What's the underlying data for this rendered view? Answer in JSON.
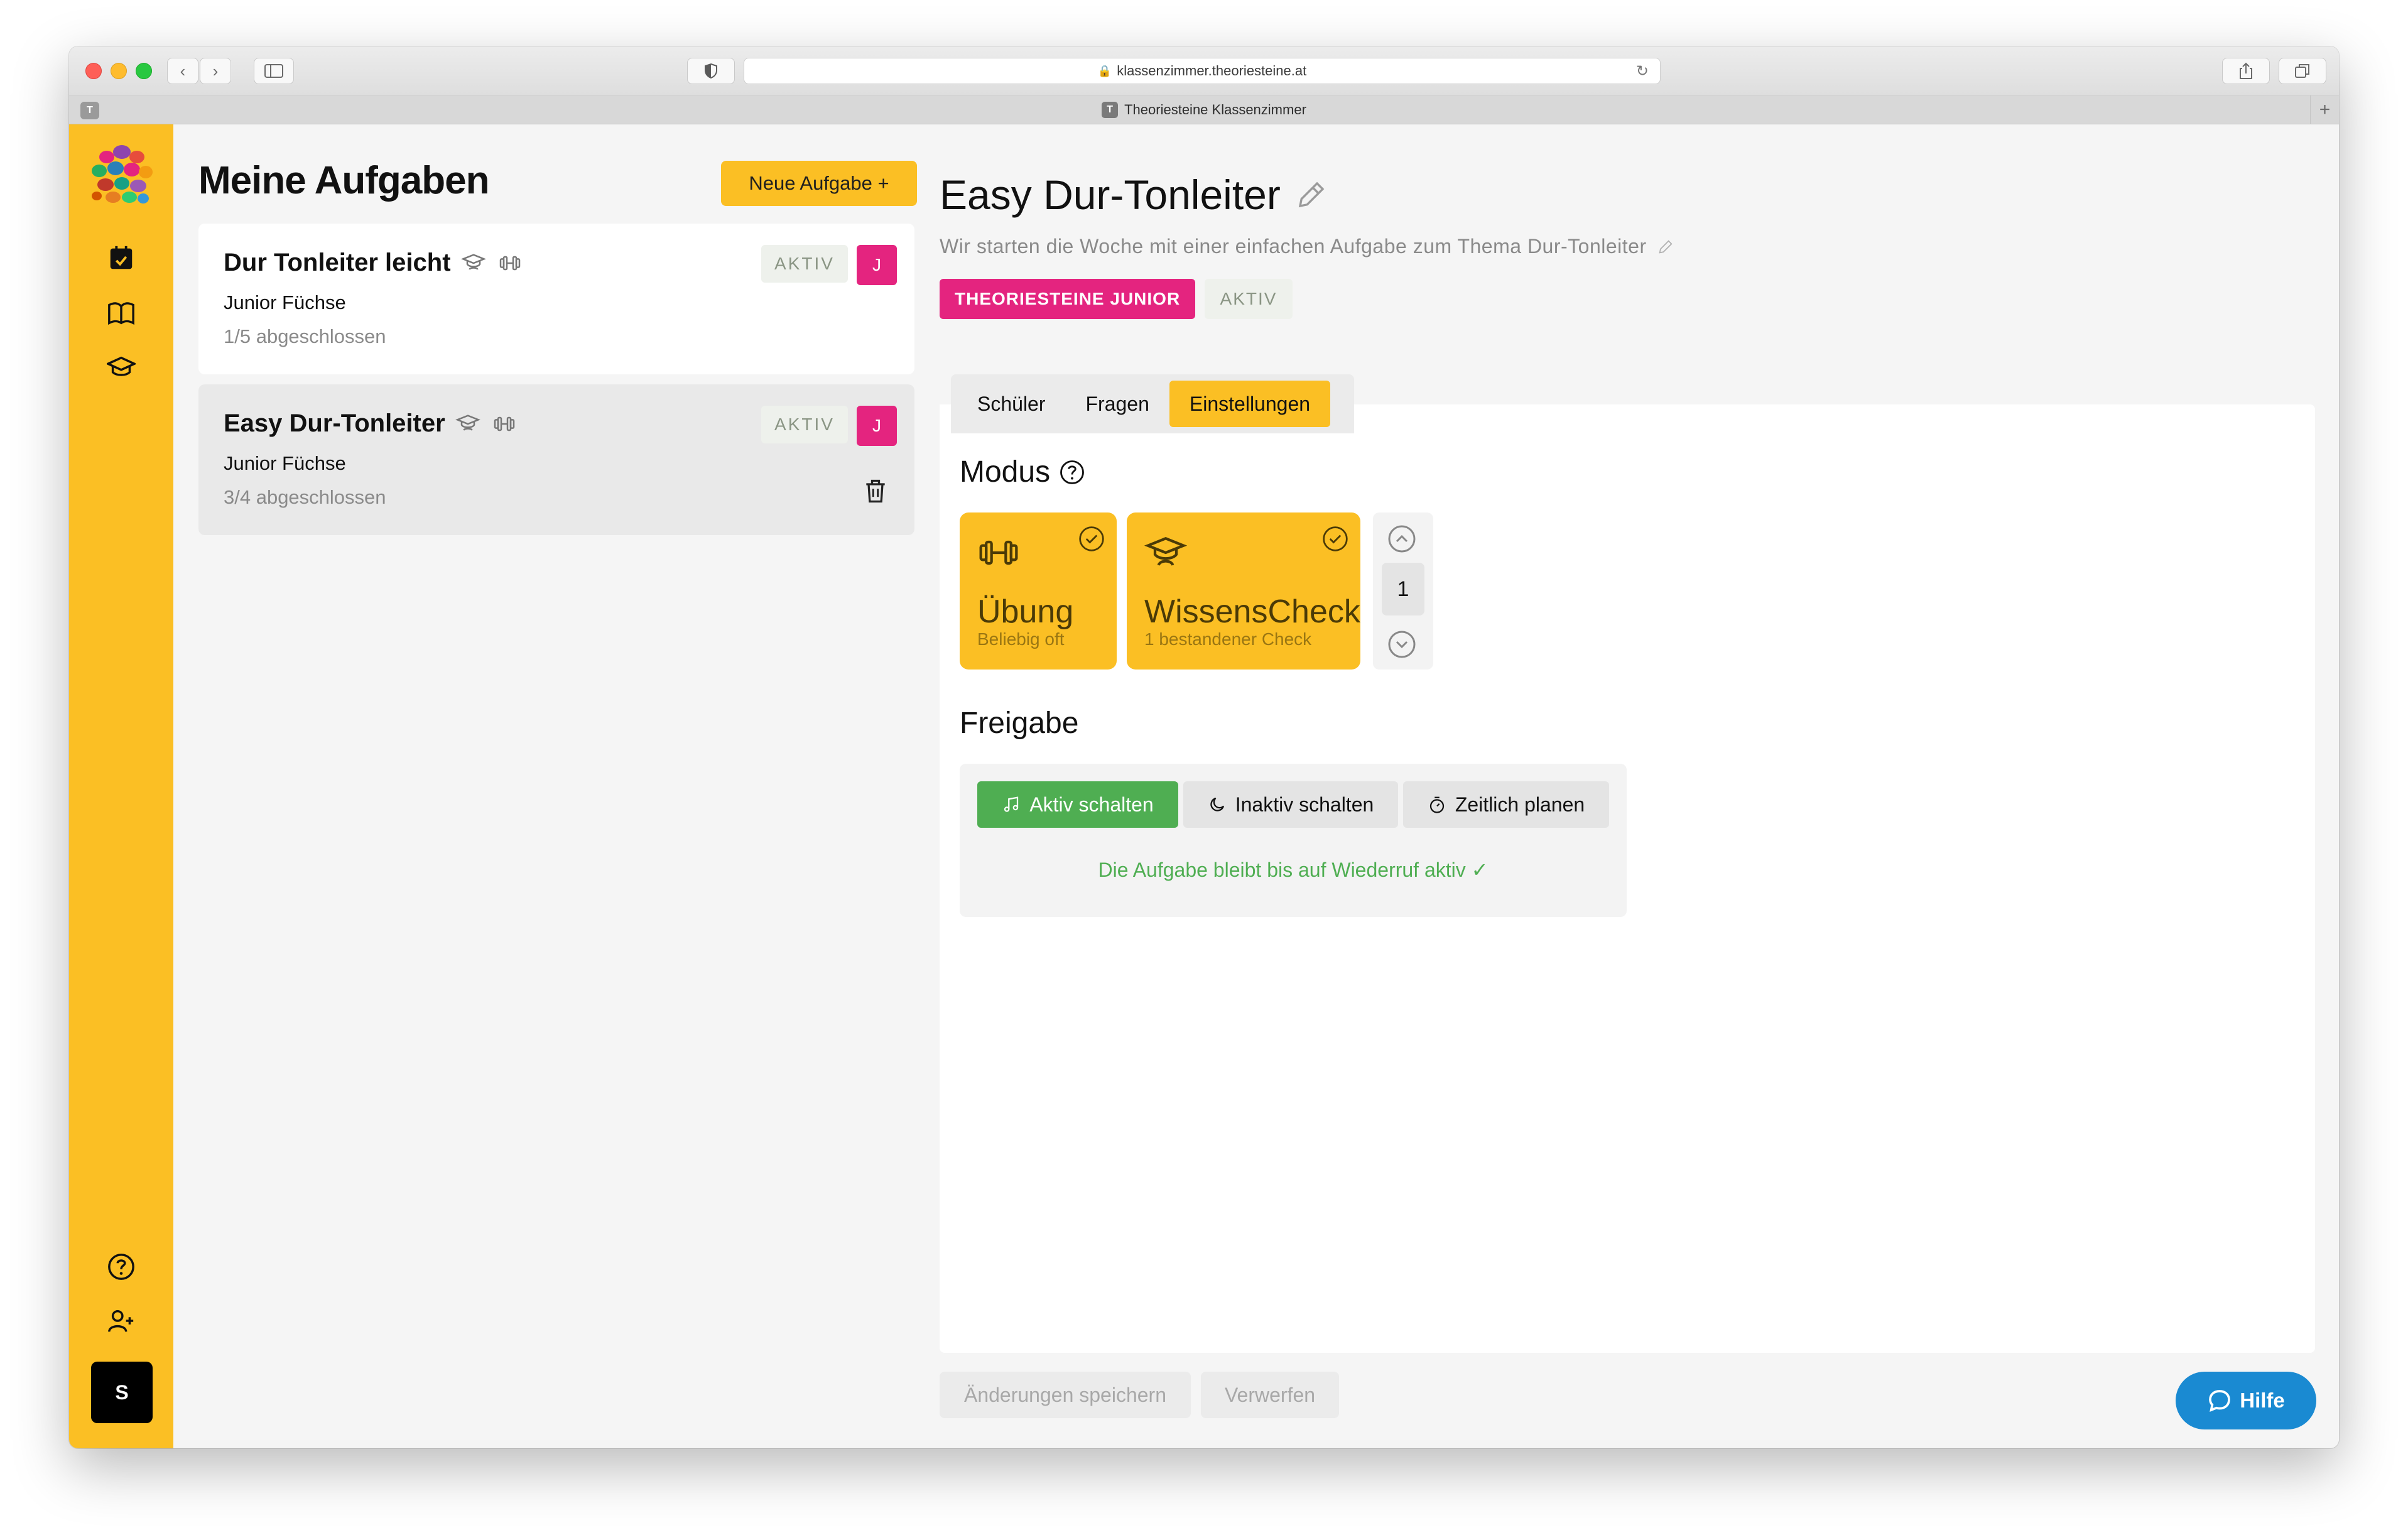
{
  "browser": {
    "url": "klassenzimmer.theoriesteine.at",
    "tab_title": "Theoriesteine Klassenzimmer",
    "tab_favicon_letter": "T",
    "pinned_tab_letter": "T",
    "new_tab_label": "+"
  },
  "sidebar": {
    "items": [
      {
        "icon": "calendar-icon",
        "active": false
      },
      {
        "icon": "book-icon",
        "active": false
      },
      {
        "icon": "graduation-cap-icon",
        "active": false
      }
    ],
    "bottom_items": [
      {
        "icon": "help-circle-icon"
      },
      {
        "icon": "add-user-icon"
      }
    ],
    "avatar_label": "S"
  },
  "task_list": {
    "title": "Meine Aufgaben",
    "new_button_label": "Neue Aufgabe +",
    "tasks": [
      {
        "title": "Dur Tonleiter leicht",
        "class_name": "Junior Füchse",
        "progress": "1/5 abgeschlossen",
        "status": "AKTIV",
        "group_initial": "J",
        "selected": false
      },
      {
        "title": "Easy Dur-Tonleiter",
        "class_name": "Junior Füchse",
        "progress": "3/4 abgeschlossen",
        "status": "AKTIV",
        "group_initial": "J",
        "selected": true
      }
    ]
  },
  "detail": {
    "title": "Easy Dur-Tonleiter",
    "description": "Wir starten die Woche mit einer einfachen Aufgabe zum Thema Dur-Tonleiter",
    "group_badge": "THEORIESTEINE JUNIOR",
    "status_badge": "AKTIV",
    "tabs": [
      {
        "label": "Schüler",
        "active": false
      },
      {
        "label": "Fragen",
        "active": false
      },
      {
        "label": "Einstellungen",
        "active": true
      }
    ],
    "mode": {
      "heading": "Modus",
      "cards": [
        {
          "title": "Übung",
          "subtitle": "Beliebig oft",
          "icon": "dumbbell-icon",
          "checked": true
        },
        {
          "title": "WissensCheck",
          "subtitle": "1 bestandener Check",
          "icon": "graduation-cap-icon",
          "checked": true
        }
      ],
      "stepper_value": "1"
    },
    "release": {
      "heading": "Freigabe",
      "buttons": [
        {
          "label": "Aktiv schalten",
          "icon": "music-note-icon",
          "active": true
        },
        {
          "label": "Inaktiv schalten",
          "icon": "moon-icon",
          "active": false
        },
        {
          "label": "Zeitlich planen",
          "icon": "stopwatch-icon",
          "active": false
        }
      ],
      "message": "Die Aufgabe bleibt bis auf Wiederruf aktiv ✓"
    },
    "footer": {
      "save_label": "Änderungen speichern",
      "discard_label": "Verwerfen",
      "help_label": "Hilfe"
    }
  },
  "colors": {
    "sidebar_yellow": "#fbbf24",
    "brand_pink": "#e4247f",
    "success_green": "#4fae52",
    "help_blue": "#1a8ad2"
  }
}
